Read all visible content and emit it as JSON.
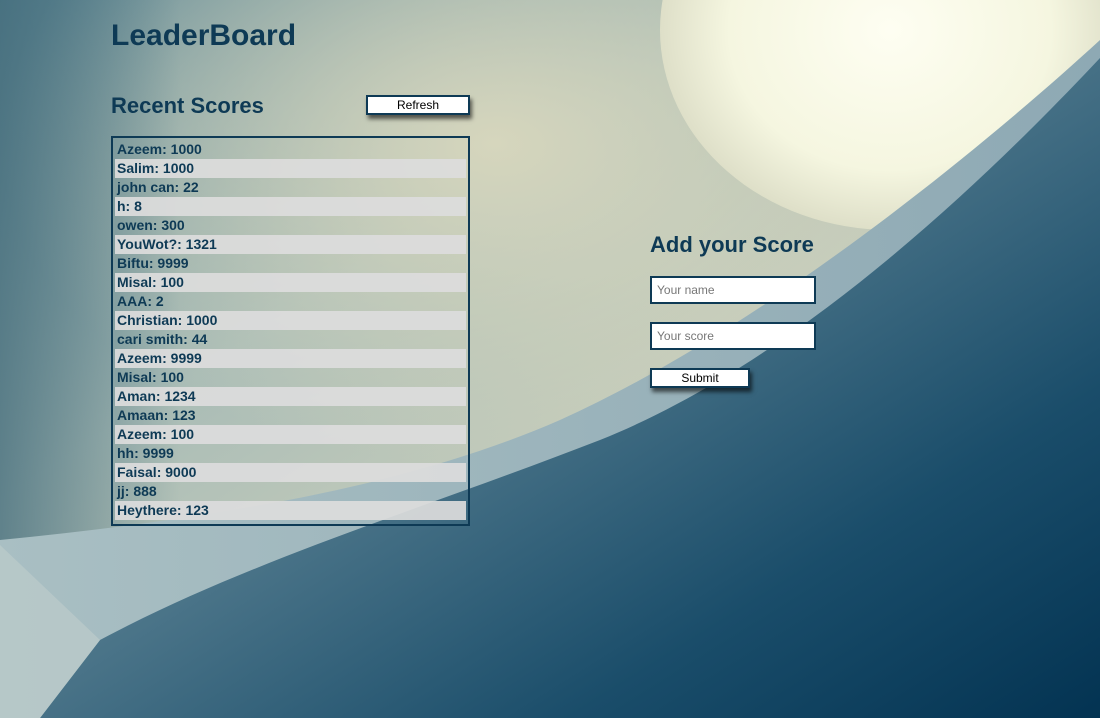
{
  "app": {
    "title": "LeaderBoard"
  },
  "recent": {
    "title": "Recent Scores",
    "refresh_label": "Refresh",
    "scores": [
      "Azeem: 1000",
      "Salim: 1000",
      "john can: 22",
      "h: 8",
      "owen: 300",
      "YouWot?: 1321",
      "Biftu: 9999",
      "Misal: 100",
      "AAA: 2",
      "Christian: 1000",
      "cari smith: 44",
      "Azeem: 9999",
      "Misal: 100",
      "Aman: 1234",
      "Amaan: 123",
      "Azeem: 100",
      "hh: 9999",
      "Faisal: 9000",
      "jj: 888",
      "Heythere: 123"
    ]
  },
  "add_score": {
    "title": "Add your Score",
    "name_placeholder": "Your name",
    "name_value": "",
    "score_placeholder": "Your score",
    "score_value": "",
    "submit_label": "Submit"
  },
  "colors": {
    "heading": "#0e3a55",
    "border": "#0e3a55",
    "stripe": "#dcdcdc",
    "button_bg": "#ffffff"
  }
}
